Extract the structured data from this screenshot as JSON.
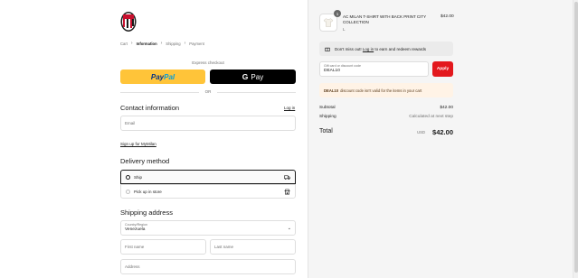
{
  "breadcrumb": {
    "cart": "Cart",
    "information": "Information",
    "shipping": "Shipping",
    "payment": "Payment"
  },
  "express": {
    "label": "Express checkout",
    "paypal_1": "Pay",
    "paypal_2": "Pal",
    "gpay_g": "G",
    "gpay_text": "Pay",
    "or": "OR"
  },
  "contact": {
    "title": "Contact information",
    "login": "Log in",
    "email_placeholder": "Email",
    "signup": "Sign up for MyMilan"
  },
  "delivery": {
    "title": "Delivery method",
    "ship": "Ship",
    "pickup": "Pick up in store"
  },
  "shipping": {
    "title": "Shipping address",
    "country_label": "Country/Region",
    "country_value": "Venezuela",
    "first_name": "First name",
    "last_name": "Last name",
    "address": "Address"
  },
  "product": {
    "quantity": "1",
    "name": "AC MILAN T-SHIRT WITH BACK PRINT CITY COLLECTION",
    "variant": "L",
    "price": "$42.00"
  },
  "rewards": {
    "prefix": "Don't miss out!",
    "link": "Log in",
    "suffix": "to earn and redeem rewards"
  },
  "discount": {
    "label": "Gift card or discount code",
    "value": "DEAL10",
    "apply": "Apply"
  },
  "alert": {
    "code": "DEAL10",
    "message": "discount code isn't valid for the items in your cart"
  },
  "summary": {
    "subtotal_label": "Subtotal",
    "subtotal": "$42.00",
    "shipping_label": "Shipping",
    "shipping": "Calculated at next step",
    "total_label": "Total",
    "currency": "USD",
    "total": "$42.00"
  },
  "colors": {
    "apply": "#e3181d",
    "paypal": "#ffc439",
    "brand_red": "#c8102e"
  }
}
